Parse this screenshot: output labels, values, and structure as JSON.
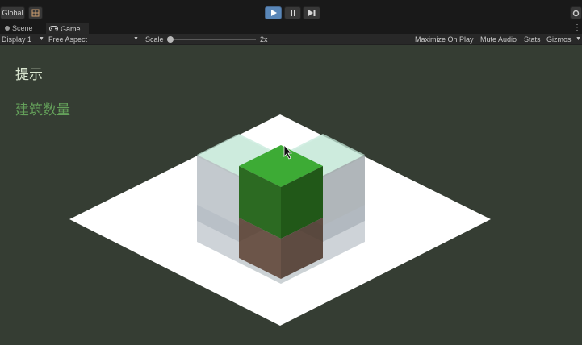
{
  "toolbar": {
    "global_label": "Global",
    "play_icon": "play-icon",
    "pause_icon": "pause-icon",
    "step_icon": "step-icon",
    "accent_color": "#5a87b8"
  },
  "tabs": [
    {
      "label": "Scene",
      "icon": "scene-icon",
      "active": false
    },
    {
      "label": "Game",
      "icon": "gamepad-icon",
      "active": true
    }
  ],
  "game_toolbar": {
    "display": "Display 1",
    "aspect": "Free Aspect",
    "scale_label": "Scale",
    "scale_value": "2x",
    "maximize": "Maximize On Play",
    "mute": "Mute Audio",
    "stats": "Stats",
    "gizmos": "Gizmos"
  },
  "game_view": {
    "hint_text": "提示",
    "building_count_label": "建筑数量",
    "background_color": "#353d33",
    "ground_color": "#ffffff",
    "selected_cube_color": "#3dab35",
    "ghost_cube_color": "#bfe7d8"
  }
}
